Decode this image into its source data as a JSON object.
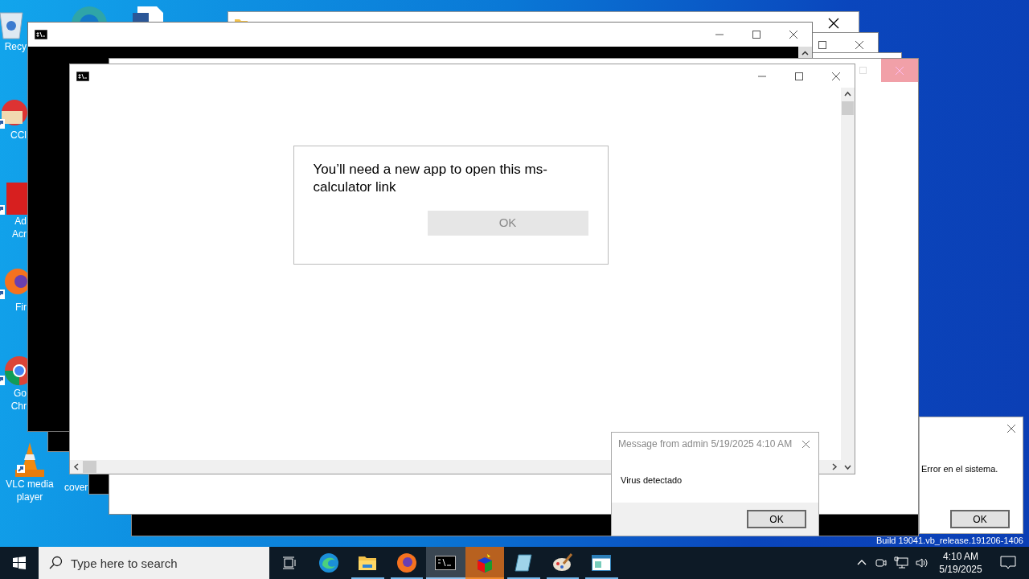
{
  "desktop_icons": [
    {
      "label": "Recy",
      "kind": "recycle"
    },
    {
      "label": "CCl",
      "kind": "ccleaner"
    },
    {
      "label": "Ad\nAcr",
      "kind": "acrobat"
    },
    {
      "label": "Fir",
      "kind": "firefox"
    },
    {
      "label": "Go\nChr",
      "kind": "chrome"
    }
  ],
  "vlc_icon": {
    "label": "VLC media\nplayer"
  },
  "cover_icon": {
    "label": "cover"
  },
  "app_dialog": {
    "message": "You’ll need a new app to open this ms-calculator link",
    "button": "OK"
  },
  "message_box": {
    "title": "Message from admin 5/19/2025 4:10 AM",
    "body": "Virus detectado",
    "button": "OK"
  },
  "error_dialog": {
    "message": "Error en el sistema.",
    "button": "OK"
  },
  "build_text": "Build 19041.vb_release.191206-1406",
  "taskbar": {
    "search_placeholder": "Type here to search",
    "apps": [
      {
        "kind": "taskview",
        "selected": false,
        "flashing": false,
        "running": false
      },
      {
        "kind": "edge",
        "selected": false,
        "flashing": false,
        "running": false
      },
      {
        "kind": "explorer",
        "selected": false,
        "flashing": false,
        "running": true
      },
      {
        "kind": "firefox",
        "selected": false,
        "flashing": false,
        "running": true
      },
      {
        "kind": "cmd",
        "selected": true,
        "flashing": false,
        "running": true
      },
      {
        "kind": "cube",
        "selected": false,
        "flashing": true,
        "running": true
      },
      {
        "kind": "notepad",
        "selected": false,
        "flashing": false,
        "running": true
      },
      {
        "kind": "paint",
        "selected": false,
        "flashing": false,
        "running": true
      },
      {
        "kind": "window",
        "selected": false,
        "flashing": false,
        "running": true
      }
    ],
    "time": "4:10 AM",
    "date": "5/19/2025"
  }
}
